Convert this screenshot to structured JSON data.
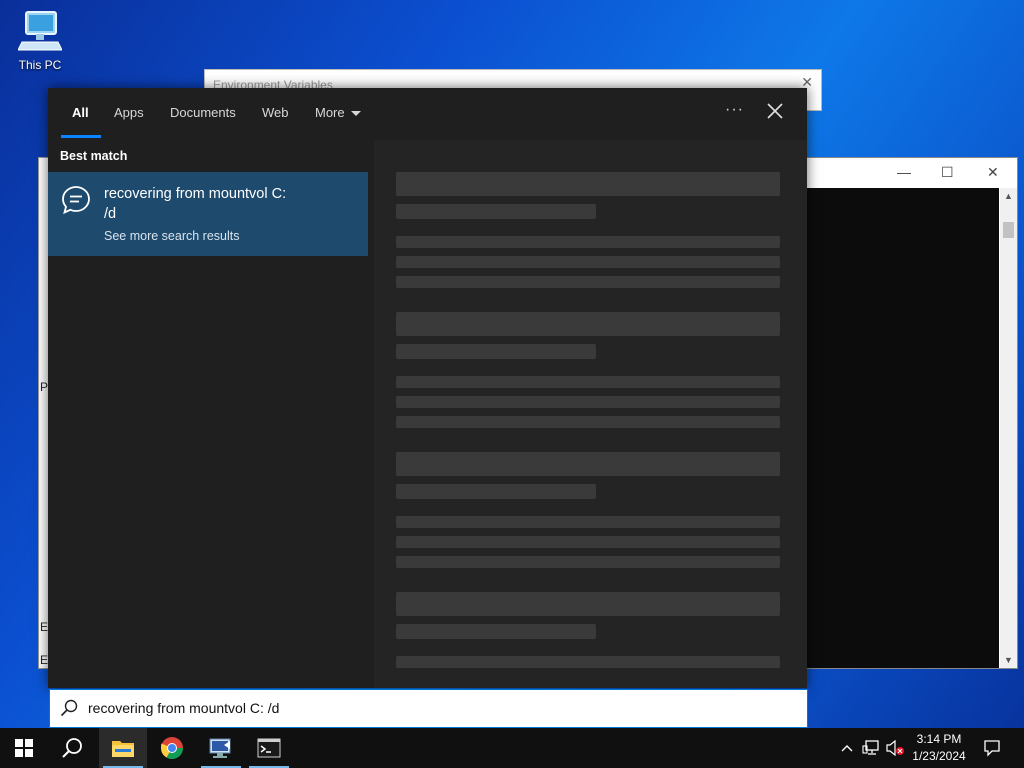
{
  "desktop": {
    "this_pc_label": "This PC"
  },
  "env_window": {
    "title": "Environment Variables",
    "close": "✕"
  },
  "left_window": {
    "letters": [
      "P",
      "E",
      "E"
    ]
  },
  "cmd_window": {
    "minimize": "—",
    "maximize": "☐",
    "close": "✕"
  },
  "search": {
    "tabs": [
      "All",
      "Apps",
      "Documents",
      "Web",
      "More"
    ],
    "active_tab": "All",
    "options_label": "···",
    "best_match_label": "Best match",
    "result_title": "recovering from mountvol C:\n/d",
    "result_line1": "recovering from mountvol C:",
    "result_line2": "/d",
    "result_subtitle": "See more search results",
    "query": "recovering from mountvol C: /d"
  },
  "taskbar": {
    "items": [
      "start-icon",
      "search-icon",
      "file-explorer-icon",
      "chrome-icon",
      "remote-desktop-icon",
      "cmd-icon"
    ],
    "clock_time": "3:14 PM",
    "clock_date": "1/23/2024"
  },
  "colors": {
    "accent": "#0a84ff",
    "selected_result": "#1e4a6e",
    "panel_bg": "#1f1f1f"
  }
}
